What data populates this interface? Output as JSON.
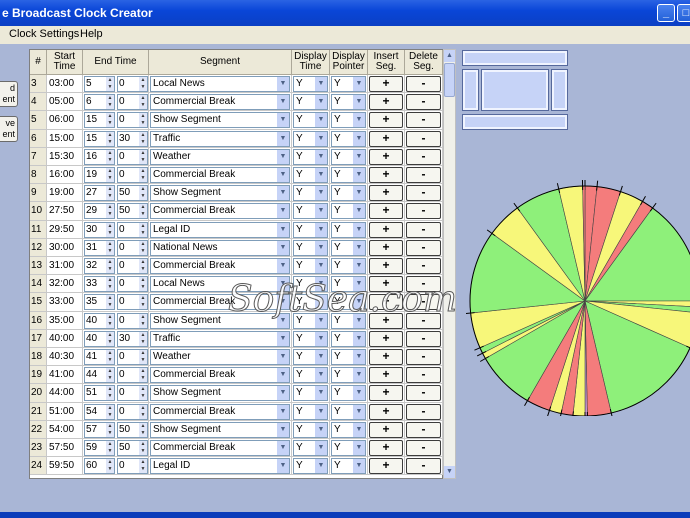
{
  "window": {
    "title": "e Broadcast Clock Creator",
    "controls": {
      "minimize": "_",
      "maximize": "□",
      "close": "×"
    }
  },
  "menu": {
    "items": [
      "Clock Settings",
      "Help"
    ]
  },
  "side_buttons": [
    "d\nent",
    "ve\nent"
  ],
  "grid": {
    "headers": {
      "num": "#",
      "start": "Start Time",
      "end": "End Time",
      "segment": "Segment",
      "display_time": "Display Time",
      "display_pointer": "Display Pointer",
      "insert": "Insert Seg.",
      "delete": "Delete Seg."
    },
    "insert_label": "+",
    "delete_label": "-",
    "rows": [
      {
        "n": "3",
        "start": "03:00",
        "em": "5",
        "es": "0",
        "seg": "Local News",
        "dt": "Y",
        "dp": "Y"
      },
      {
        "n": "4",
        "start": "05:00",
        "em": "6",
        "es": "0",
        "seg": "Commercial Break",
        "dt": "Y",
        "dp": "Y"
      },
      {
        "n": "5",
        "start": "06:00",
        "em": "15",
        "es": "0",
        "seg": "Show Segment",
        "dt": "Y",
        "dp": "Y"
      },
      {
        "n": "6",
        "start": "15:00",
        "em": "15",
        "es": "30",
        "seg": "Traffic",
        "dt": "Y",
        "dp": "Y"
      },
      {
        "n": "7",
        "start": "15:30",
        "em": "16",
        "es": "0",
        "seg": "Weather",
        "dt": "Y",
        "dp": "Y"
      },
      {
        "n": "8",
        "start": "16:00",
        "em": "19",
        "es": "0",
        "seg": "Commercial Break",
        "dt": "Y",
        "dp": "Y"
      },
      {
        "n": "9",
        "start": "19:00",
        "em": "27",
        "es": "50",
        "seg": "Show Segment",
        "dt": "Y",
        "dp": "Y"
      },
      {
        "n": "10",
        "start": "27:50",
        "em": "29",
        "es": "50",
        "seg": "Commercial Break",
        "dt": "Y",
        "dp": "Y"
      },
      {
        "n": "11",
        "start": "29:50",
        "em": "30",
        "es": "0",
        "seg": "Legal ID",
        "dt": "Y",
        "dp": "Y"
      },
      {
        "n": "12",
        "start": "30:00",
        "em": "31",
        "es": "0",
        "seg": "National News",
        "dt": "Y",
        "dp": "Y"
      },
      {
        "n": "13",
        "start": "31:00",
        "em": "32",
        "es": "0",
        "seg": "Commercial Break",
        "dt": "Y",
        "dp": "Y"
      },
      {
        "n": "14",
        "start": "32:00",
        "em": "33",
        "es": "0",
        "seg": "Local News",
        "dt": "Y",
        "dp": "Y"
      },
      {
        "n": "15",
        "start": "33:00",
        "em": "35",
        "es": "0",
        "seg": "Commercial Break",
        "dt": "Y",
        "dp": "Y"
      },
      {
        "n": "16",
        "start": "35:00",
        "em": "40",
        "es": "0",
        "seg": "Show Segment",
        "dt": "Y",
        "dp": "Y"
      },
      {
        "n": "17",
        "start": "40:00",
        "em": "40",
        "es": "30",
        "seg": "Traffic",
        "dt": "Y",
        "dp": "Y"
      },
      {
        "n": "18",
        "start": "40:30",
        "em": "41",
        "es": "0",
        "seg": "Weather",
        "dt": "Y",
        "dp": "Y"
      },
      {
        "n": "19",
        "start": "41:00",
        "em": "44",
        "es": "0",
        "seg": "Commercial Break",
        "dt": "Y",
        "dp": "Y"
      },
      {
        "n": "20",
        "start": "44:00",
        "em": "51",
        "es": "0",
        "seg": "Show Segment",
        "dt": "Y",
        "dp": "Y"
      },
      {
        "n": "21",
        "start": "51:00",
        "em": "54",
        "es": "0",
        "seg": "Commercial Break",
        "dt": "Y",
        "dp": "Y"
      },
      {
        "n": "22",
        "start": "54:00",
        "em": "57",
        "es": "50",
        "seg": "Show Segment",
        "dt": "Y",
        "dp": "Y"
      },
      {
        "n": "23",
        "start": "57:50",
        "em": "59",
        "es": "50",
        "seg": "Commercial Break",
        "dt": "Y",
        "dp": "Y"
      },
      {
        "n": "24",
        "start": "59:50",
        "em": "60",
        "es": "0",
        "seg": "Legal ID",
        "dt": "Y",
        "dp": "Y"
      }
    ]
  },
  "clock": {
    "segments": [
      {
        "start": 0,
        "end": 1,
        "color": "#f47c7c"
      },
      {
        "start": 1,
        "end": 3,
        "color": "#f47c7c"
      },
      {
        "start": 3,
        "end": 5,
        "color": "#f7f77a"
      },
      {
        "start": 5,
        "end": 6,
        "color": "#f47c7c"
      },
      {
        "start": 6,
        "end": 15,
        "color": "#8ef07a"
      },
      {
        "start": 15,
        "end": 15.5,
        "color": "#f7f77a"
      },
      {
        "start": 15.5,
        "end": 16,
        "color": "#8ef07a"
      },
      {
        "start": 16,
        "end": 19,
        "color": "#f7f77a"
      },
      {
        "start": 19,
        "end": 27.8,
        "color": "#8ef07a"
      },
      {
        "start": 27.8,
        "end": 29.8,
        "color": "#f47c7c"
      },
      {
        "start": 29.8,
        "end": 30,
        "color": "#c896d8"
      },
      {
        "start": 30,
        "end": 31,
        "color": "#f7f77a"
      },
      {
        "start": 31,
        "end": 32,
        "color": "#f47c7c"
      },
      {
        "start": 32,
        "end": 33,
        "color": "#f7f77a"
      },
      {
        "start": 33,
        "end": 35,
        "color": "#f47c7c"
      },
      {
        "start": 35,
        "end": 40,
        "color": "#8ef07a"
      },
      {
        "start": 40,
        "end": 40.5,
        "color": "#f7f77a"
      },
      {
        "start": 40.5,
        "end": 41,
        "color": "#8ef07a"
      },
      {
        "start": 41,
        "end": 44,
        "color": "#f7f77a"
      },
      {
        "start": 44,
        "end": 51,
        "color": "#8ef07a"
      },
      {
        "start": 51,
        "end": 54,
        "color": "#f7f77a"
      },
      {
        "start": 54,
        "end": 57.8,
        "color": "#8ef07a"
      },
      {
        "start": 57.8,
        "end": 59.8,
        "color": "#f7f77a"
      },
      {
        "start": 59.8,
        "end": 60,
        "color": "#f47c7c"
      }
    ]
  },
  "watermark": "SoftSea.com"
}
